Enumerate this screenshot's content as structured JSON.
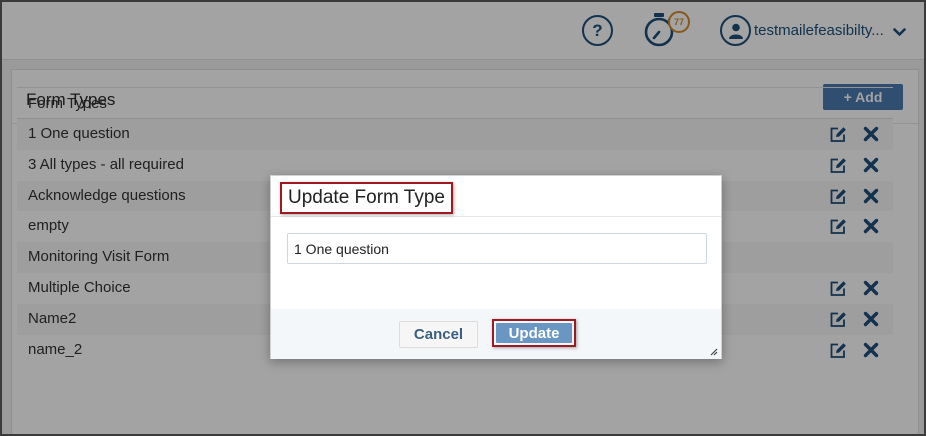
{
  "header": {
    "help_label": "?",
    "timer_badge": "77",
    "user_name": "testmailefeasibilty..."
  },
  "panel": {
    "title": "Form Types",
    "add_label": "+ Add"
  },
  "table": {
    "column_header": "Form Types",
    "rows": [
      {
        "name": "1 One question",
        "has_actions": true
      },
      {
        "name": "3 All types - all required",
        "has_actions": true
      },
      {
        "name": "Acknowledge questions",
        "has_actions": true
      },
      {
        "name": "empty",
        "has_actions": true
      },
      {
        "name": "Monitoring Visit Form",
        "has_actions": false
      },
      {
        "name": "Multiple Choice",
        "has_actions": true
      },
      {
        "name": "Name2",
        "has_actions": true
      },
      {
        "name": "name_2",
        "has_actions": true
      }
    ]
  },
  "dialog": {
    "title": "Update Form Type",
    "input_value": "1 One question",
    "cancel_label": "Cancel",
    "update_label": "Update"
  },
  "colors": {
    "brand": "#1d4f7a",
    "accent_button": "#4a7ab0",
    "highlight_border": "#a01820",
    "badge": "#d28a2b"
  },
  "icons": {
    "help": "question-circle-icon",
    "timer": "stopwatch-icon",
    "user": "user-circle-icon",
    "menu": "chevron-down-icon",
    "edit": "edit-icon",
    "delete": "close-icon"
  }
}
